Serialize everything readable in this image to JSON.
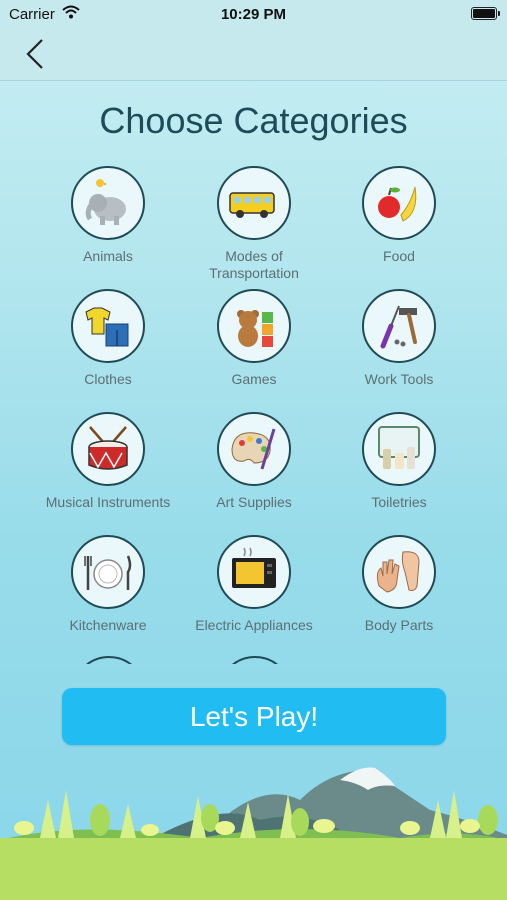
{
  "status": {
    "carrier": "Carrier",
    "time": "10:29 PM"
  },
  "nav": {
    "back_icon": "chevron-left-icon"
  },
  "title": "Choose Categories",
  "categories": [
    {
      "label": "Animals",
      "icon": "elephant-icon"
    },
    {
      "label": "Modes of Transportation",
      "icon": "school-bus-icon"
    },
    {
      "label": "Food",
      "icon": "fruit-icon"
    },
    {
      "label": "Clothes",
      "icon": "clothes-icon"
    },
    {
      "label": "Games",
      "icon": "teddy-bear-icon"
    },
    {
      "label": "Work Tools",
      "icon": "tools-icon"
    },
    {
      "label": "Musical Instruments",
      "icon": "drum-icon"
    },
    {
      "label": "Art Supplies",
      "icon": "palette-icon"
    },
    {
      "label": "Toiletries",
      "icon": "toiletries-icon"
    },
    {
      "label": "Kitchenware",
      "icon": "plate-icon"
    },
    {
      "label": "Electric Appliances",
      "icon": "oven-icon"
    },
    {
      "label": "Body Parts",
      "icon": "hand-foot-icon"
    }
  ],
  "play_button": "Let's Play!",
  "colors": {
    "accent": "#20bcf2",
    "title": "#1d4b58",
    "ring": "#1f4b56"
  }
}
